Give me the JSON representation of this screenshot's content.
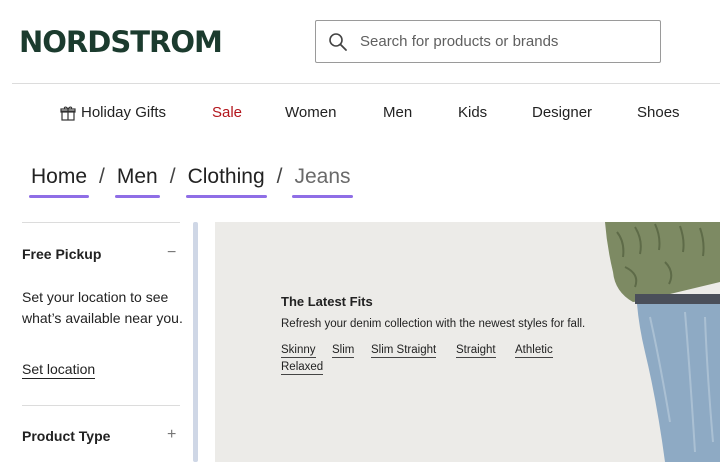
{
  "header": {
    "logo": "NORDSTROM",
    "search_placeholder": "Search for products or brands",
    "search_icon": "search-icon"
  },
  "nav": {
    "items": [
      {
        "label": "Holiday Gifts",
        "icon": "gift-icon"
      },
      {
        "label": "Sale",
        "color": "#b3151c"
      },
      {
        "label": "Women"
      },
      {
        "label": "Men"
      },
      {
        "label": "Kids"
      },
      {
        "label": "Designer"
      },
      {
        "label": "Shoes"
      }
    ]
  },
  "breadcrumb": {
    "items": [
      "Home",
      "Men",
      "Clothing",
      "Jeans"
    ],
    "separator": "/",
    "underline_color": "#8f6ee6"
  },
  "sidebar": {
    "free_pickup": {
      "title": "Free Pickup",
      "toggle": "−",
      "text": "Set your location to see what’s available near you.",
      "link": "Set location"
    },
    "product_type": {
      "title": "Product Type",
      "toggle": "+"
    }
  },
  "hero": {
    "title": "The Latest Fits",
    "subtitle": "Refresh your denim collection with the newest styles for fall.",
    "fits": [
      "Skinny",
      "Slim",
      "Slim Straight",
      "Straight",
      "Athletic",
      "Relaxed"
    ]
  },
  "colors": {
    "brand": "#1b3b2e",
    "sale": "#b3151c",
    "accent": "#8f6ee6"
  }
}
